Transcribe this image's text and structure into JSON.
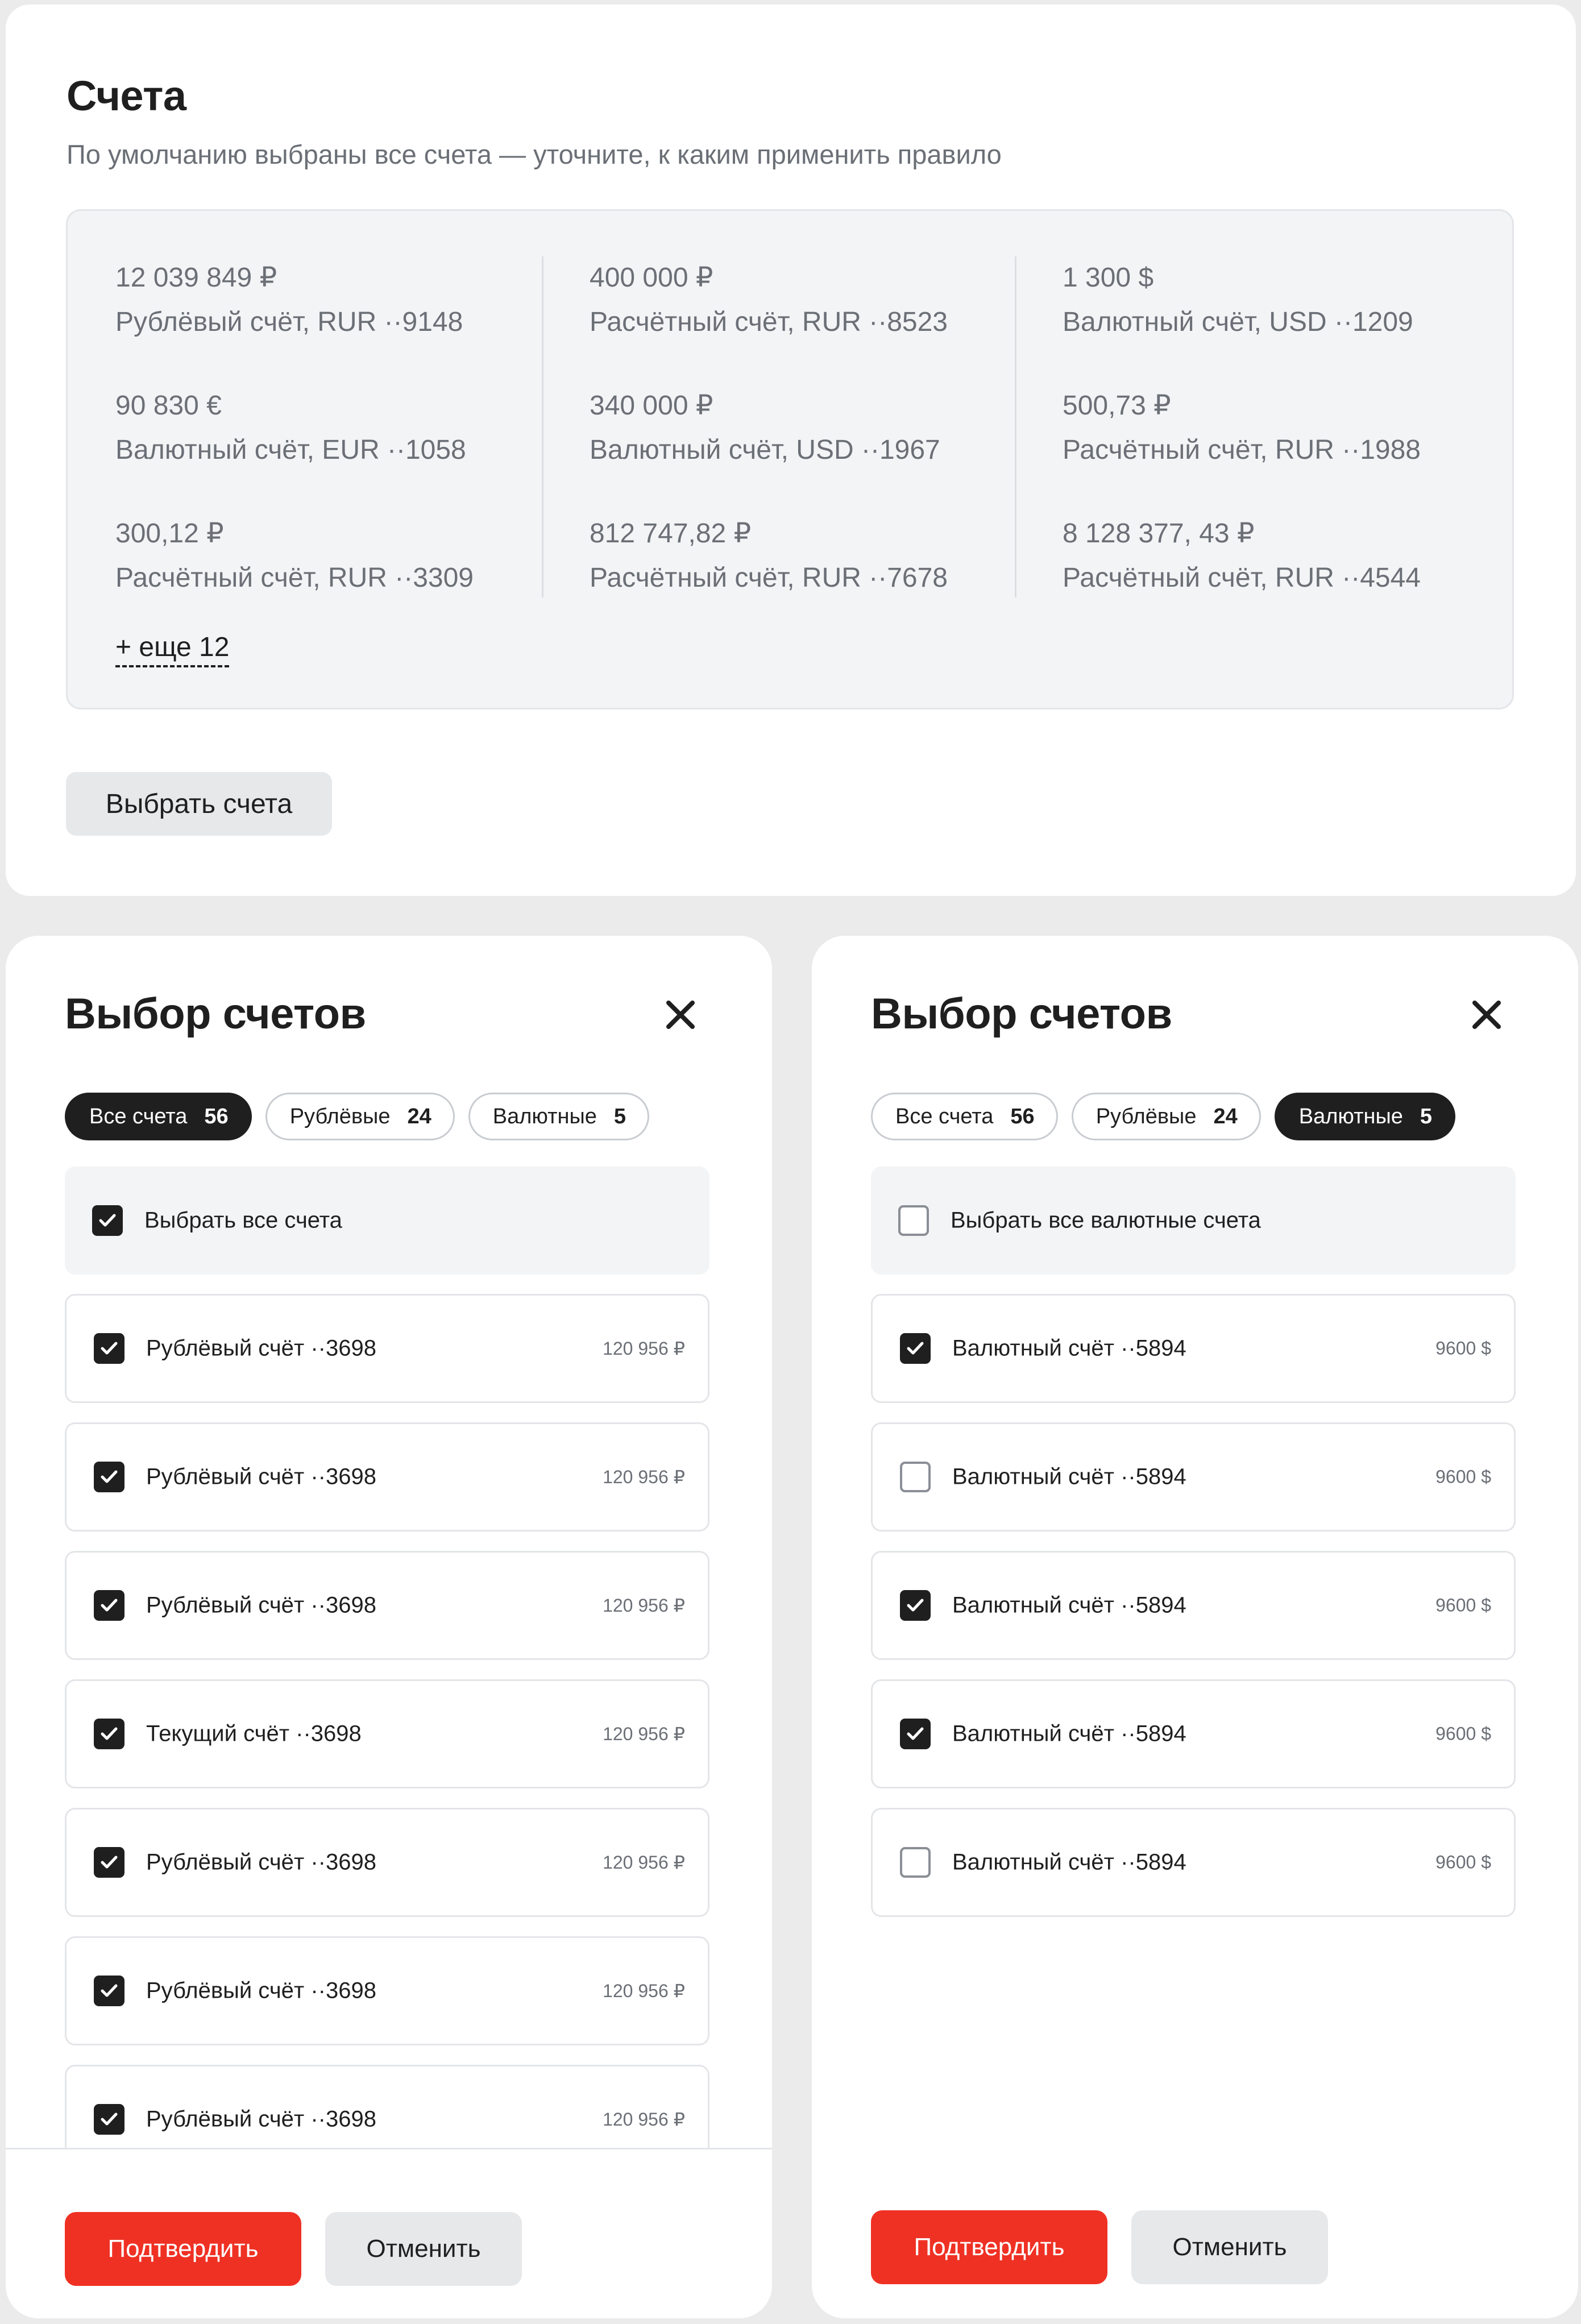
{
  "accounts_card": {
    "title": "Счета",
    "subtitle": "По умолчанию выбраны все счета — уточните, к каким применить правило",
    "columns": [
      [
        {
          "amount": "12 039 849 ₽",
          "name": "Рублёвый счёт, RUR  ··9148"
        },
        {
          "amount": "90 830 €",
          "name": "Валютный счёт, EUR  ··1058"
        },
        {
          "amount": "300,12 ₽",
          "name": "Расчётный счёт, RUR  ··3309"
        }
      ],
      [
        {
          "amount": "400 000 ₽",
          "name": "Расчётный счёт, RUR  ··8523"
        },
        {
          "amount": "340 000 ₽",
          "name": "Валютный счёт, USD  ··1967"
        },
        {
          "amount": "812 747,82 ₽",
          "name": "Расчётный счёт, RUR  ··7678"
        }
      ],
      [
        {
          "amount": "1 300 $",
          "name": "Валютный счёт, USD ··1209"
        },
        {
          "amount": "500,73 ₽",
          "name": "Расчётный счёт, RUR  ··1988"
        },
        {
          "amount": "8 128 377, 43 ₽",
          "name": "Расчётный счёт, RUR  ··4544"
        }
      ]
    ],
    "more_link": "+ еще 12",
    "select_button": "Выбрать счета"
  },
  "modals": [
    {
      "title": "Выбор счетов",
      "close_icon": "close-icon",
      "chips": [
        {
          "label": "Все счета",
          "count": "56",
          "active": true
        },
        {
          "label": "Рублёвые",
          "count": "24",
          "active": false
        },
        {
          "label": "Валютные",
          "count": "5",
          "active": false
        }
      ],
      "select_all": {
        "label": "Выбрать все счета",
        "checked": true
      },
      "rows": [
        {
          "label": "Рублёвый счёт ··3698",
          "amount": "120 956 ₽",
          "checked": true
        },
        {
          "label": "Рублёвый счёт ··3698",
          "amount": "120 956 ₽",
          "checked": true
        },
        {
          "label": "Рублёвый счёт ··3698",
          "amount": "120 956 ₽",
          "checked": true
        },
        {
          "label": "Текущий счёт ··3698",
          "amount": "120 956 ₽",
          "checked": true
        },
        {
          "label": "Рублёвый счёт ··3698",
          "amount": "120 956 ₽",
          "checked": true
        },
        {
          "label": "Рублёвый счёт ··3698",
          "amount": "120 956 ₽",
          "checked": true
        },
        {
          "label": "Рублёвый счёт ··3698",
          "amount": "120 956 ₽",
          "checked": true
        }
      ],
      "confirm": "Подтвердить",
      "cancel": "Отменить"
    },
    {
      "title": "Выбор счетов",
      "close_icon": "close-icon",
      "chips": [
        {
          "label": "Все счета",
          "count": "56",
          "active": false
        },
        {
          "label": "Рублёвые",
          "count": "24",
          "active": false
        },
        {
          "label": "Валютные",
          "count": "5",
          "active": true
        }
      ],
      "select_all": {
        "label": "Выбрать все валютные счета",
        "checked": false
      },
      "rows": [
        {
          "label": "Валютный счёт ··5894",
          "amount": "9600 $",
          "checked": true
        },
        {
          "label": "Валютный счёт ··5894",
          "amount": "9600 $",
          "checked": false
        },
        {
          "label": "Валютный счёт ··5894",
          "amount": "9600 $",
          "checked": true
        },
        {
          "label": "Валютный счёт ··5894",
          "amount": "9600 $",
          "checked": true
        },
        {
          "label": "Валютный счёт ··5894",
          "amount": "9600 $",
          "checked": false
        }
      ],
      "confirm": "Подтвердить",
      "cancel": "Отменить"
    }
  ],
  "colors": {
    "accent_red": "#ef3124",
    "dark": "#1f1f1f",
    "muted_text": "#6b6f76",
    "panel_bg": "#f3f4f6",
    "page_bg": "#ebebeb"
  }
}
